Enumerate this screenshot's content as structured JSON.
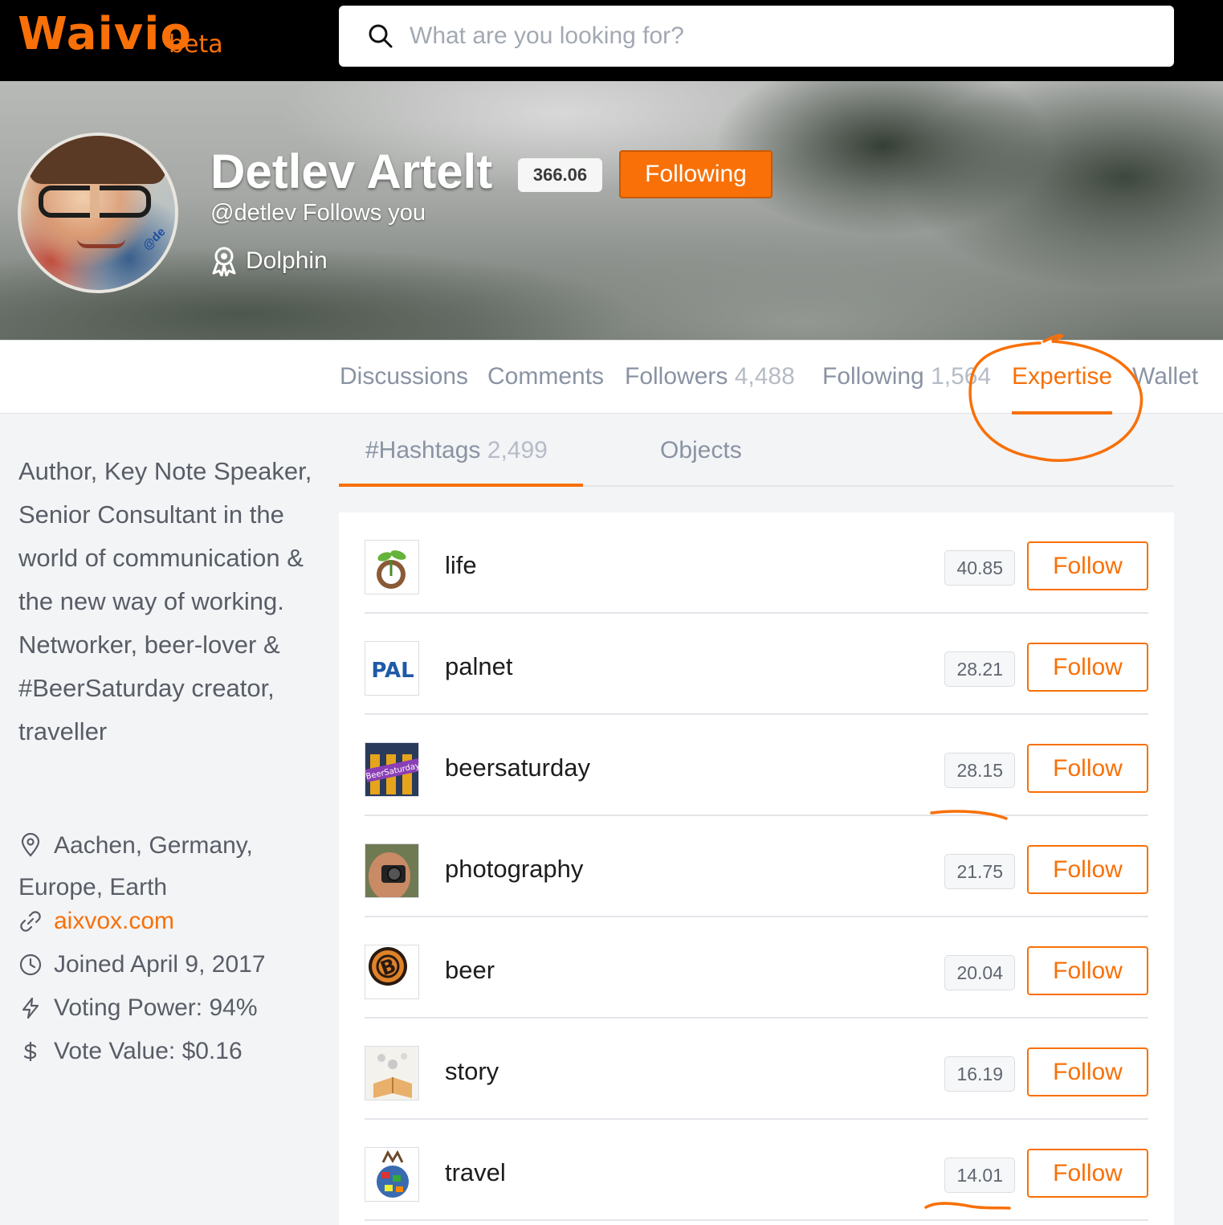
{
  "header": {
    "logo": "Waivio",
    "logo_suffix": "beta",
    "search_placeholder": "What are you looking for?",
    "search_icon": "search-icon"
  },
  "profile": {
    "name": "Detlev Artelt",
    "reputation": "366.06",
    "follow_button": "Following",
    "handle": "@detlev",
    "follows_you": "Follows you",
    "rank": "Dolphin",
    "avatar_tag": "@de"
  },
  "tabs": [
    {
      "label": "Discussions",
      "count": ""
    },
    {
      "label": "Comments",
      "count": ""
    },
    {
      "label": "Followers",
      "count": "4,488"
    },
    {
      "label": "Following",
      "count": "1,564"
    },
    {
      "label": "Expertise",
      "count": ""
    },
    {
      "label": "Wallet",
      "count": ""
    }
  ],
  "active_tab": "Expertise",
  "sidebar": {
    "bio": "Author, Key Note Speaker, Senior Consultant in the world of communication & the new way of working. Networker, beer-lover & #BeerSaturday creator, traveller",
    "location": "Aachen, Germany, Europe, Earth",
    "website": "aixvox.com",
    "joined": "Joined April 9, 2017",
    "voting_power": "Voting Power: 94%",
    "vote_value": "Vote Value: $0.16"
  },
  "subtabs": [
    {
      "label": "#Hashtags",
      "count": "2,499"
    },
    {
      "label": "Objects",
      "count": ""
    }
  ],
  "hashtags": [
    {
      "name": "life",
      "score": "40.85",
      "action": "Follow"
    },
    {
      "name": "palnet",
      "score": "28.21",
      "action": "Follow"
    },
    {
      "name": "beersaturday",
      "score": "28.15",
      "action": "Follow"
    },
    {
      "name": "photography",
      "score": "21.75",
      "action": "Follow"
    },
    {
      "name": "beer",
      "score": "20.04",
      "action": "Follow"
    },
    {
      "name": "story",
      "score": "16.19",
      "action": "Follow"
    },
    {
      "name": "travel",
      "score": "14.01",
      "action": "Follow"
    }
  ],
  "icon_texts": {
    "palnet": "PAL",
    "beersaturday": "BeerSaturday",
    "beer": "B"
  },
  "colors": {
    "accent": "#f87007",
    "topbar": "#000000",
    "muted_text": "#8a93a3"
  }
}
